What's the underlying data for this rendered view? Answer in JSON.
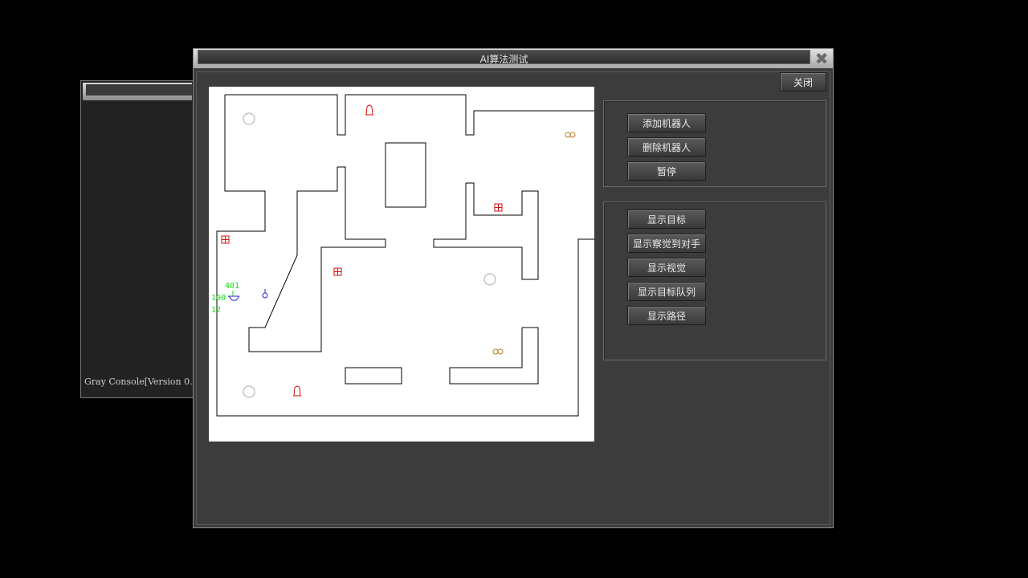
{
  "console": {
    "text": "Gray Console[Version 0."
  },
  "window": {
    "title": "AI算法测试",
    "close_icon": "close-x-icon"
  },
  "buttons": {
    "close": "关闭",
    "add_robot": "添加机器人",
    "delete_robot": "删除机器人",
    "pause": "暂停",
    "show_target": "显示目标",
    "show_opponent": "显示察觉到对手",
    "show_vision": "显示视觉",
    "show_target_queue": "显示目标队列",
    "show_path": "显示路径"
  },
  "map": {
    "robot": {
      "id_label": "401",
      "hp": "100",
      "ammo": "12"
    },
    "colors": {
      "wall": "#000000",
      "robot_hud": "#11dd11",
      "robot": "#2222cc",
      "bell": "#cc1111",
      "health_pack": "#cc1111",
      "ammo": "#b87a1a",
      "spawn": "#aaaaaa"
    }
  }
}
